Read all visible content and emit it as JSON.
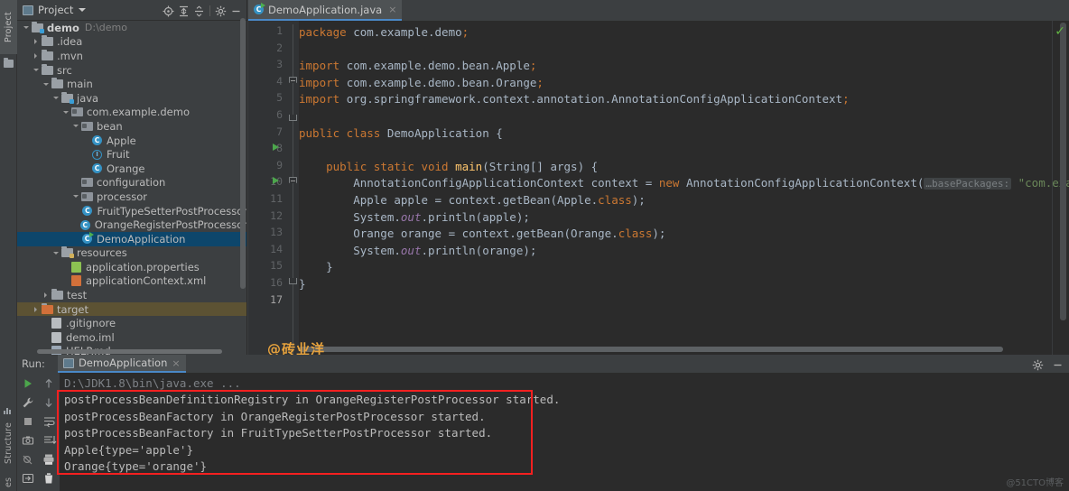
{
  "left_strip": {
    "tabs": [
      {
        "label": "Project",
        "icon": "project-icon"
      },
      {
        "label": "Structure",
        "icon": "structure-icon"
      },
      {
        "label": "es",
        "icon": "favorites-icon"
      }
    ]
  },
  "project_panel": {
    "title": "Project",
    "caret": "chevron-down-icon",
    "toolbar": [
      {
        "name": "locate-icon",
        "tip": "Select Opened File"
      },
      {
        "name": "expand-all-icon",
        "tip": "Expand All"
      },
      {
        "name": "collapse-all-icon",
        "tip": "Collapse All"
      },
      {
        "name": "gear-icon",
        "tip": "Settings"
      },
      {
        "name": "minimize-icon",
        "tip": "Hide"
      }
    ],
    "tree": [
      {
        "label": "demo",
        "path": "D:\\demo",
        "indent": 0,
        "arrow": "down",
        "icon": "module-folder",
        "bold": true,
        "state": "normal"
      },
      {
        "label": ".idea",
        "path": "",
        "indent": 1,
        "arrow": "right",
        "icon": "folder",
        "bold": false,
        "state": "normal"
      },
      {
        "label": ".mvn",
        "path": "",
        "indent": 1,
        "arrow": "right",
        "icon": "folder",
        "bold": false,
        "state": "normal"
      },
      {
        "label": "src",
        "path": "",
        "indent": 1,
        "arrow": "down",
        "icon": "folder",
        "bold": false,
        "state": "normal"
      },
      {
        "label": "main",
        "path": "",
        "indent": 2,
        "arrow": "down",
        "icon": "folder",
        "bold": false,
        "state": "normal"
      },
      {
        "label": "java",
        "path": "",
        "indent": 3,
        "arrow": "down",
        "icon": "source-folder",
        "bold": false,
        "state": "normal"
      },
      {
        "label": "com.example.demo",
        "path": "",
        "indent": 4,
        "arrow": "down",
        "icon": "package",
        "bold": false,
        "state": "normal"
      },
      {
        "label": "bean",
        "path": "",
        "indent": 5,
        "arrow": "down",
        "icon": "package",
        "bold": false,
        "state": "normal"
      },
      {
        "label": "Apple",
        "path": "",
        "indent": 6,
        "arrow": "none",
        "icon": "class",
        "bold": false,
        "state": "normal"
      },
      {
        "label": "Fruit",
        "path": "",
        "indent": 6,
        "arrow": "none",
        "icon": "interface",
        "bold": false,
        "state": "normal"
      },
      {
        "label": "Orange",
        "path": "",
        "indent": 6,
        "arrow": "none",
        "icon": "class",
        "bold": false,
        "state": "normal"
      },
      {
        "label": "configuration",
        "path": "",
        "indent": 5,
        "arrow": "none",
        "icon": "package",
        "bold": false,
        "state": "normal"
      },
      {
        "label": "processor",
        "path": "",
        "indent": 5,
        "arrow": "down",
        "icon": "package",
        "bold": false,
        "state": "normal"
      },
      {
        "label": "FruitTypeSetterPostProcessor",
        "path": "",
        "indent": 6,
        "arrow": "none",
        "icon": "class",
        "bold": false,
        "state": "normal"
      },
      {
        "label": "OrangeRegisterPostProcessor",
        "path": "",
        "indent": 6,
        "arrow": "none",
        "icon": "class",
        "bold": false,
        "state": "normal"
      },
      {
        "label": "DemoApplication",
        "path": "",
        "indent": 5,
        "arrow": "none",
        "icon": "runnable-class",
        "bold": false,
        "state": "selected"
      },
      {
        "label": "resources",
        "path": "",
        "indent": 3,
        "arrow": "down",
        "icon": "resource-folder",
        "bold": false,
        "state": "normal"
      },
      {
        "label": "application.properties",
        "path": "",
        "indent": 4,
        "arrow": "none",
        "icon": "properties-file",
        "bold": false,
        "state": "normal"
      },
      {
        "label": "applicationContext.xml",
        "path": "",
        "indent": 4,
        "arrow": "none",
        "icon": "xml-file",
        "bold": false,
        "state": "normal"
      },
      {
        "label": "test",
        "path": "",
        "indent": 2,
        "arrow": "right",
        "icon": "folder",
        "bold": false,
        "state": "normal"
      },
      {
        "label": "target",
        "path": "",
        "indent": 1,
        "arrow": "right",
        "icon": "excluded-folder",
        "bold": false,
        "state": "highlighted"
      },
      {
        "label": ".gitignore",
        "path": "",
        "indent": 2,
        "arrow": "none",
        "icon": "gitignore-file",
        "bold": false,
        "state": "normal"
      },
      {
        "label": "demo.iml",
        "path": "",
        "indent": 2,
        "arrow": "none",
        "icon": "iml-file",
        "bold": false,
        "state": "normal"
      },
      {
        "label": "HELP.md",
        "path": "",
        "indent": 2,
        "arrow": "none",
        "icon": "markdown-file",
        "bold": false,
        "state": "normal"
      }
    ]
  },
  "editor": {
    "tab": {
      "label": "DemoApplication.java",
      "close": "×",
      "icon": "runnable-class-icon"
    },
    "inspection_status": "✓",
    "watermark": "@砖业洋__",
    "lines": [
      {
        "num": 1,
        "tokens": [
          {
            "t": "package ",
            "c": "kw"
          },
          {
            "t": "com.example.demo",
            "c": "pln"
          },
          {
            "t": ";",
            "c": "kw"
          }
        ]
      },
      {
        "num": 2,
        "tokens": []
      },
      {
        "num": 3,
        "tokens": [
          {
            "t": "import ",
            "c": "kw"
          },
          {
            "t": "com.example.demo.bean.Apple",
            "c": "pln"
          },
          {
            "t": ";",
            "c": "kw"
          }
        ]
      },
      {
        "num": 4,
        "tokens": [
          {
            "t": "import ",
            "c": "kw"
          },
          {
            "t": "com.example.demo.bean.Orange",
            "c": "pln"
          },
          {
            "t": ";",
            "c": "kw"
          }
        ]
      },
      {
        "num": 5,
        "tokens": [
          {
            "t": "import ",
            "c": "kw"
          },
          {
            "t": "org.springframework.context.annotation.AnnotationConfigApplicationContext",
            "c": "pln"
          },
          {
            "t": ";",
            "c": "kw"
          }
        ]
      },
      {
        "num": 6,
        "tokens": []
      },
      {
        "num": 7,
        "tokens": [
          {
            "t": "public class ",
            "c": "kw"
          },
          {
            "t": "DemoApplication {",
            "c": "pln"
          }
        ]
      },
      {
        "num": 8,
        "tokens": []
      },
      {
        "num": 9,
        "tokens": [
          {
            "t": "    ",
            "c": "pln"
          },
          {
            "t": "public static void ",
            "c": "kw"
          },
          {
            "t": "main",
            "c": "mth"
          },
          {
            "t": "(String[] args) {",
            "c": "pln"
          }
        ]
      },
      {
        "num": 10,
        "tokens": [
          {
            "t": "        AnnotationConfigApplicationContext context = ",
            "c": "pln"
          },
          {
            "t": "new ",
            "c": "kw"
          },
          {
            "t": "AnnotationConfigApplicationContext(",
            "c": "pln"
          },
          {
            "t": "…basePackages:",
            "c": "hint"
          },
          {
            "t": " ",
            "c": "pln"
          },
          {
            "t": "\"com.example.demo\"",
            "c": "str"
          }
        ]
      },
      {
        "num": 11,
        "tokens": [
          {
            "t": "        Apple apple = context.getBean(Apple.",
            "c": "pln"
          },
          {
            "t": "class",
            "c": "kw"
          },
          {
            "t": ");",
            "c": "pln"
          }
        ]
      },
      {
        "num": 12,
        "tokens": [
          {
            "t": "        System.",
            "c": "pln"
          },
          {
            "t": "out",
            "c": "fld"
          },
          {
            "t": ".println(apple);",
            "c": "pln"
          }
        ]
      },
      {
        "num": 13,
        "tokens": [
          {
            "t": "        Orange orange = context.getBean(Orange.",
            "c": "pln"
          },
          {
            "t": "class",
            "c": "kw"
          },
          {
            "t": ");",
            "c": "pln"
          }
        ]
      },
      {
        "num": 14,
        "tokens": [
          {
            "t": "        System.",
            "c": "pln"
          },
          {
            "t": "out",
            "c": "fld"
          },
          {
            "t": ".println(orange);",
            "c": "pln"
          }
        ]
      },
      {
        "num": 15,
        "tokens": [
          {
            "t": "    }",
            "c": "pln"
          }
        ]
      },
      {
        "num": 16,
        "tokens": [
          {
            "t": "}",
            "c": "pln"
          }
        ]
      },
      {
        "num": 17,
        "tokens": []
      }
    ]
  },
  "run_panel": {
    "label": "Run:",
    "tab": {
      "label": "DemoApplication",
      "close": "×",
      "icon": "run-config-icon"
    },
    "toolbar": [
      {
        "name": "gear-icon"
      },
      {
        "name": "minimize-icon"
      }
    ],
    "side_buttons": [
      {
        "name": "rerun-icon"
      },
      {
        "name": "settings-wrench-icon"
      },
      {
        "name": "stop-icon"
      },
      {
        "name": "camera-icon"
      },
      {
        "name": "debug-off-icon"
      },
      {
        "name": "export-icon"
      },
      {
        "name": "soft-wrap-icon"
      },
      {
        "name": "scroll-to-end-icon"
      },
      {
        "name": "print-icon"
      },
      {
        "name": "trash-icon"
      }
    ],
    "console": [
      {
        "text": "D:\\JDK1.8\\bin\\java.exe ...",
        "kind": "cmd"
      },
      {
        "text": "postProcessBeanDefinitionRegistry in OrangeRegisterPostProcessor started.",
        "kind": "out"
      },
      {
        "text": "postProcessBeanFactory in OrangeRegisterPostProcessor started.",
        "kind": "out"
      },
      {
        "text": "postProcessBeanFactory in FruitTypeSetterPostProcessor started.",
        "kind": "out"
      },
      {
        "text": "Apple{type='apple'}",
        "kind": "out"
      },
      {
        "text": "Orange{type='orange'}",
        "kind": "out"
      }
    ],
    "highlight_box_color": "#f42020",
    "watermark": "@51CTO博客"
  }
}
